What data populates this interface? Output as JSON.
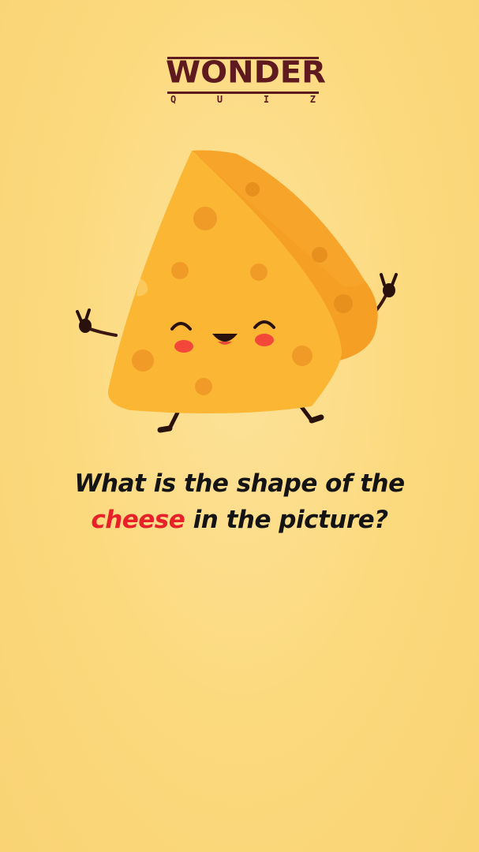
{
  "logo": {
    "word": "WONDER",
    "sub_letters": [
      "Q",
      "U",
      "I",
      "Z"
    ]
  },
  "question": {
    "line1": "What is the shape of the",
    "highlight": "cheese",
    "line2_rest": " in the picture?"
  },
  "colors": {
    "background": "#fbd97c",
    "logo": "#5e1a1f",
    "question_text": "#141414",
    "highlight": "#e8202a",
    "cheese_face": "#fbb734",
    "cheese_top": "#f7a52a",
    "cheese_side": "#f59f24"
  },
  "illustration": {
    "subject": "cheese-wedge-character",
    "icons": [
      "cheese-icon",
      "peace-sign-hand-icon"
    ]
  }
}
